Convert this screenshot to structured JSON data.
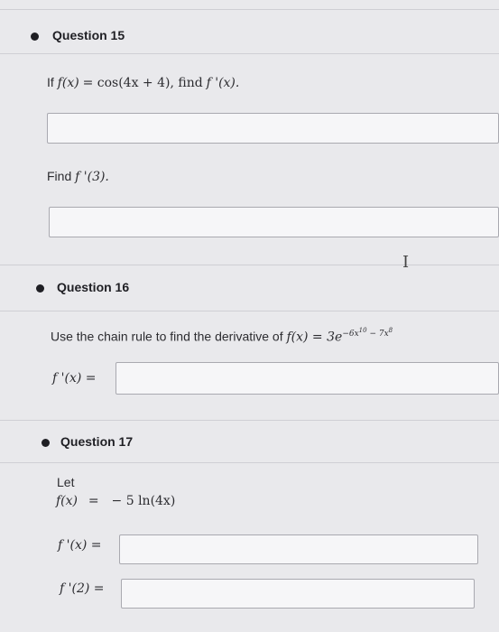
{
  "q15": {
    "title": "Question 15",
    "prompt_prefix": "If",
    "prompt_func": "f(x)",
    "prompt_eq": "= cos(4x + 4), find",
    "prompt_deriv": "f '(x).",
    "find_label": "Find",
    "find_expr": "f '(3).",
    "answer1": "",
    "answer2": ""
  },
  "q16": {
    "title": "Question 16",
    "prompt_text": "Use the chain rule to find the derivative of",
    "prompt_func": "f(x) = 3e",
    "exponent": "−6x",
    "exp_pow1": "10",
    "exponent_mid": " − 7x",
    "exp_pow2": "8",
    "answer_label": "f '(x) =",
    "answer": ""
  },
  "q17": {
    "title": "Question 17",
    "let_label": "Let",
    "def_func": "f(x)",
    "def_eq": "=",
    "def_expr": "− 5 ln(4x)",
    "deriv_label": "f '(x) =",
    "value_label": "f '(2) =",
    "answer1": "",
    "answer2": ""
  },
  "icons": {
    "text_cursor": "I"
  }
}
